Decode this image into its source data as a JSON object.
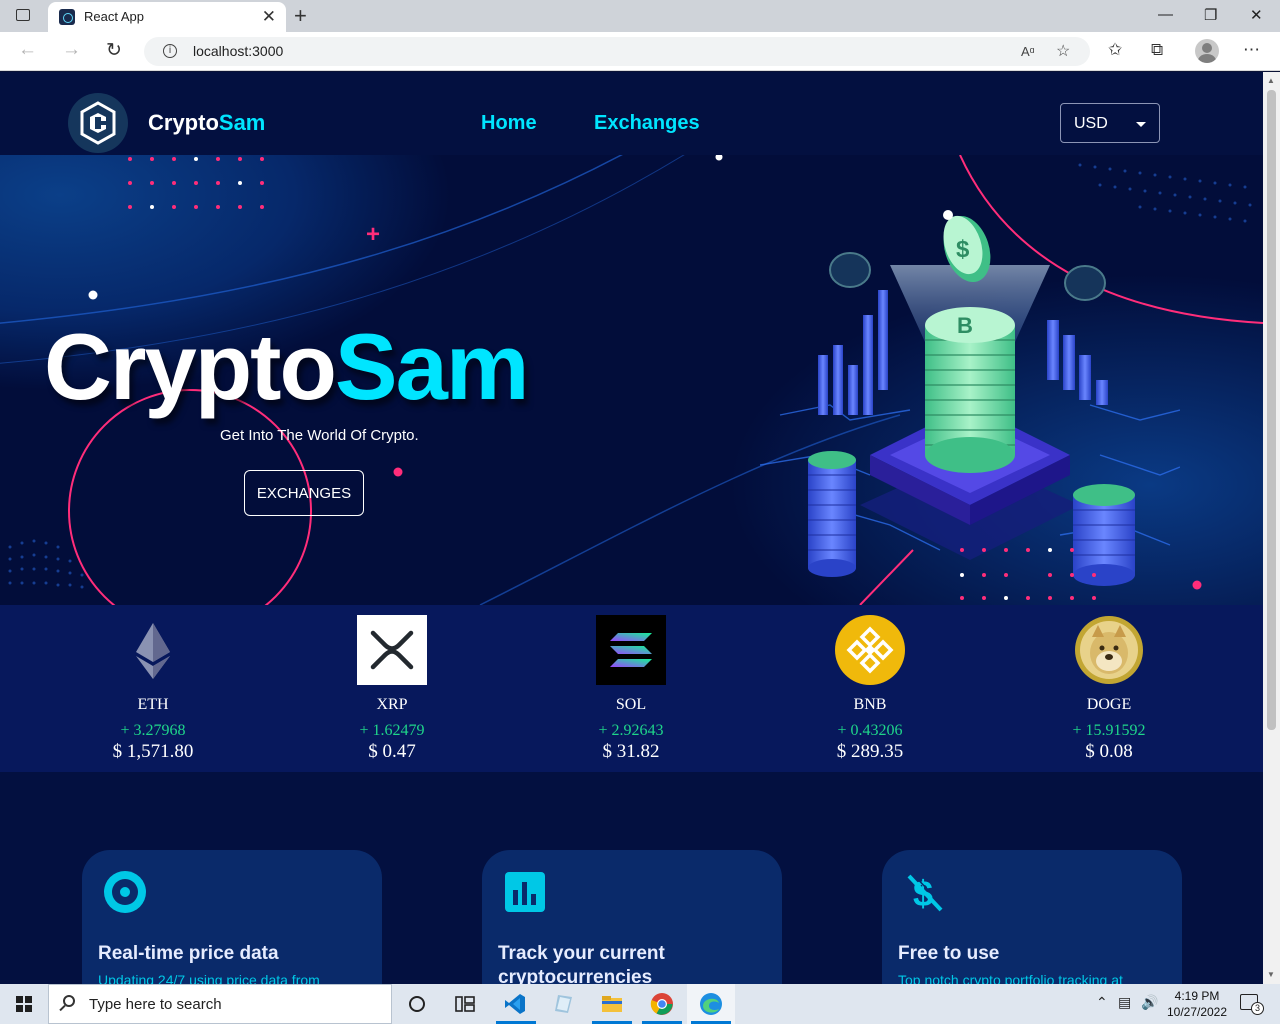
{
  "browser": {
    "tab_title": "React App",
    "url": "localhost:3000",
    "read_aloud": "A̅",
    "new_tab": "+",
    "close_tab": "✕"
  },
  "nav": {
    "brand_part1": "Crypto",
    "brand_part2": "Sam",
    "links": [
      "Home",
      "Exchanges"
    ],
    "currency": "USD"
  },
  "hero": {
    "title_part1": "Crypto",
    "title_part2": "Sam",
    "subtitle": "Get Into The World Of Crypto.",
    "button": "EXCHANGES"
  },
  "coins": [
    {
      "symbol": "ETH",
      "change": "+ 3.27968",
      "price": "$ 1,571.80",
      "logo": "ethereum-icon"
    },
    {
      "symbol": "XRP",
      "change": "+ 1.62479",
      "price": "$ 0.47",
      "logo": "xrp-icon"
    },
    {
      "symbol": "SOL",
      "change": "+ 2.92643",
      "price": "$ 31.82",
      "logo": "solana-icon"
    },
    {
      "symbol": "BNB",
      "change": "+ 0.43206",
      "price": "$ 289.35",
      "logo": "binance-icon"
    },
    {
      "symbol": "DOGE",
      "change": "+ 15.91592",
      "price": "$ 0.08",
      "logo": "dogecoin-icon"
    }
  ],
  "features": [
    {
      "title": "Real-time price data",
      "desc": "Updating 24/7 using price data from",
      "icon": "target-icon"
    },
    {
      "title": "Track your current cryptocurrencies",
      "desc": "",
      "icon": "bar-chart-icon"
    },
    {
      "title": "Free to use",
      "desc": "Top notch crypto portfolio tracking at",
      "icon": "no-dollar-icon"
    }
  ],
  "taskbar": {
    "search_placeholder": "Type here to search",
    "time": "4:19 PM",
    "date": "10/27/2022",
    "notifications": "3"
  },
  "colors": {
    "accent": "#00e5ff",
    "page_bg": "#031040",
    "ticker_bg": "#07185c",
    "card_bg": "#0a2a6a",
    "positive": "#1fd68a",
    "pink": "#ff2d7a"
  }
}
